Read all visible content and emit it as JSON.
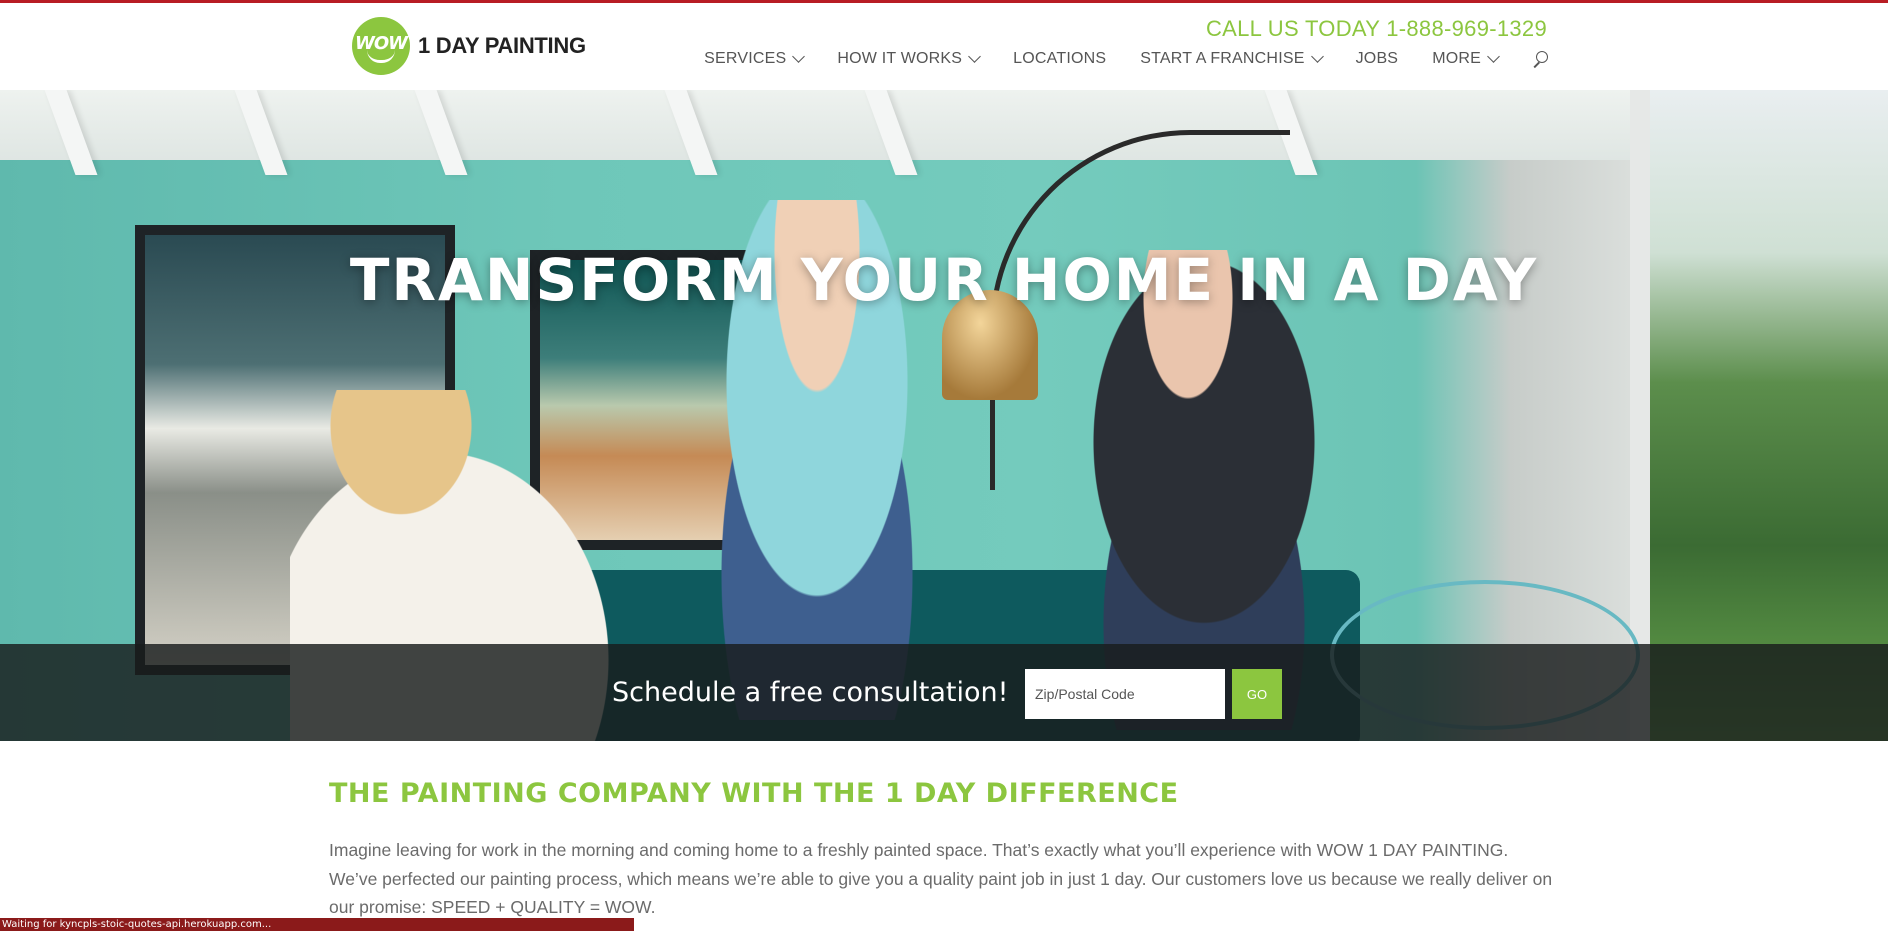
{
  "header": {
    "logo_badge": "WOW",
    "logo_text": "1 DAY PAINTING",
    "call_us": "CALL US TODAY 1-888-969-1329",
    "nav": [
      {
        "label": "SERVICES",
        "has_dropdown": true
      },
      {
        "label": "HOW IT WORKS",
        "has_dropdown": true
      },
      {
        "label": "LOCATIONS",
        "has_dropdown": false
      },
      {
        "label": "START A FRANCHISE",
        "has_dropdown": true
      },
      {
        "label": "JOBS",
        "has_dropdown": false
      },
      {
        "label": "MORE",
        "has_dropdown": true
      }
    ],
    "search_icon": "search-icon"
  },
  "hero": {
    "title": "TRANSFORM YOUR HOME IN A DAY",
    "consult_text": "Schedule a free consultation!",
    "zip_placeholder": "Zip/Postal Code",
    "go_label": "GO"
  },
  "content": {
    "title": "THE PAINTING COMPANY WITH THE 1 DAY DIFFERENCE",
    "body": "Imagine leaving for work in the morning and coming home to a freshly painted space. That’s exactly what you’ll experience with WOW 1 DAY PAINTING. We’ve perfected our painting process, which means we’re able to give you a quality paint job in just 1 day. Our customers love us because we really deliver on our promise: SPEED + QUALITY = WOW."
  },
  "status_bar": "Waiting for kyncpls-stoic-quotes-api.herokuapp.com...",
  "colors": {
    "accent_green": "#8cc63f",
    "top_rule": "#b81d24"
  }
}
